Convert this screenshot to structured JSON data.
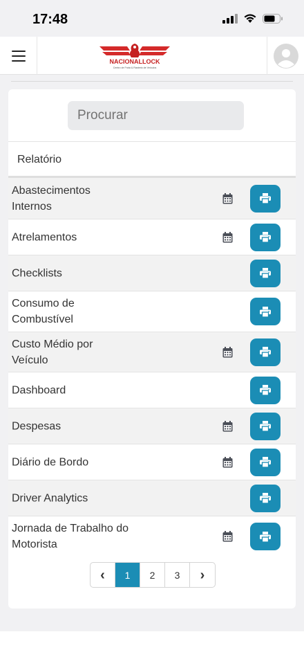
{
  "status_bar": {
    "time": "17:48",
    "icons": [
      "signal-icon",
      "wifi-icon",
      "battery-icon"
    ]
  },
  "header": {
    "menu_icon": "hamburger-icon",
    "logo_text": "NACIONALLOCK",
    "logo_tagline": "Centro de Frota & Rastreio de Veículos",
    "avatar_icon": "user-avatar-icon"
  },
  "search": {
    "placeholder": "Procurar",
    "value": ""
  },
  "table": {
    "column_header": "Relatório",
    "rows": [
      {
        "label": "Abastecimentos Internos",
        "has_calendar": true
      },
      {
        "label": "Atrelamentos",
        "has_calendar": true
      },
      {
        "label": "Checklists",
        "has_calendar": false
      },
      {
        "label": "Consumo de Combustível",
        "has_calendar": false
      },
      {
        "label": "Custo Médio por Veículo",
        "has_calendar": true
      },
      {
        "label": "Dashboard",
        "has_calendar": false
      },
      {
        "label": "Despesas",
        "has_calendar": true
      },
      {
        "label": "Diário de Bordo",
        "has_calendar": true
      },
      {
        "label": "Driver Analytics",
        "has_calendar": false
      },
      {
        "label": "Jornada de Trabalho do Motorista",
        "has_calendar": true
      }
    ]
  },
  "pagination": {
    "prev": "‹",
    "pages": [
      "1",
      "2",
      "3"
    ],
    "current": "1",
    "next": "›"
  },
  "colors": {
    "accent": "#1b8db5",
    "row_alt": "#f2f2f2",
    "logo_red": "#d42a2a"
  }
}
